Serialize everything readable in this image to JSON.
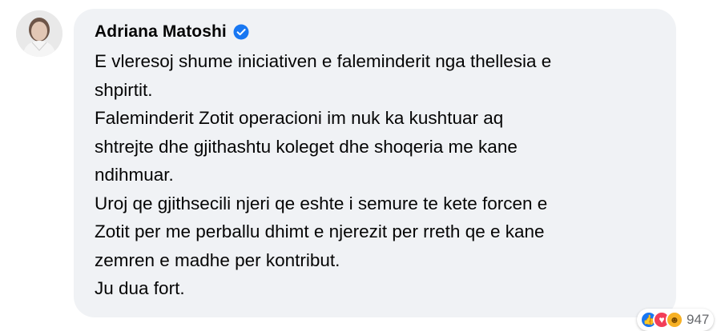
{
  "comment": {
    "author": "Adriana Matoshi",
    "lines": [
      "E vleresoj shume iniciativen e faleminderit nga thellesia e",
      "shpirtit.",
      "Faleminderit Zotit operacioni im nuk ka kushtuar aq",
      "shtrejte dhe gjithashtu koleget dhe shoqeria me kane",
      "ndihmuar.",
      "Uroj qe gjithsecili njeri qe eshte i semure te kete forcen e",
      "Zotit per me perballu dhimt e njerezit per rreth qe e kane",
      "zemren e madhe per kontribut.",
      "Ju dua fort."
    ],
    "reactions": {
      "icons": [
        "like-icon",
        "love-icon",
        "care-icon"
      ],
      "count": "947"
    }
  },
  "colors": {
    "bubble": "#f0f2f5",
    "text": "#050505",
    "verified": "#1877f2",
    "secondary_text": "#65676b"
  }
}
